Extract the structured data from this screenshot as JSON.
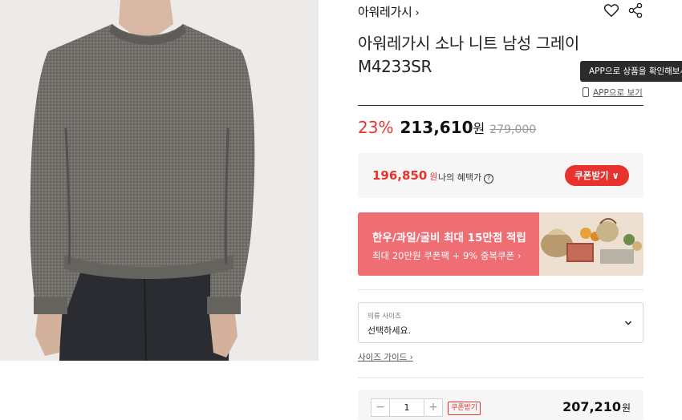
{
  "product": {
    "brand": "아워레가시",
    "brand_chevron": "›",
    "title_line1": "아워레가시 소나 니트 남성 그레이",
    "title_line2": "M4233SR",
    "image_alt": "product-photo"
  },
  "app": {
    "tooltip": "APP으로 상품을 확인해보세요",
    "link": "APP으로 보기"
  },
  "price": {
    "discount": "23%",
    "sale": "213,610",
    "unit": "원",
    "original": "279,000"
  },
  "benefit": {
    "price": "196,850",
    "unit": "원",
    "label": "나의 혜택가",
    "info_glyph": "?",
    "coupon_button": "쿠폰받기 ∨"
  },
  "banner": {
    "title": "한우/과일/굴비 최대 15만점 적립",
    "subtitle": "최대 20만원 쿠폰팩 + 9% 중복쿠폰 ›",
    "color": "#ef6e73"
  },
  "size_select": {
    "label": "의류 사이즈",
    "value": "선택하세요."
  },
  "size_guide": "사이즈 가이드 ›",
  "order": {
    "minus": "−",
    "quantity": "1",
    "plus": "+",
    "coupon": "쿠폰받기",
    "total": "207,210",
    "total_unit": "원"
  },
  "colors": {
    "accent": "#e8322d",
    "panel_bg": "#f6f6f6"
  },
  "icons": [
    "heart-icon",
    "share-icon",
    "phone-icon",
    "info-icon",
    "chevron-down-icon"
  ]
}
